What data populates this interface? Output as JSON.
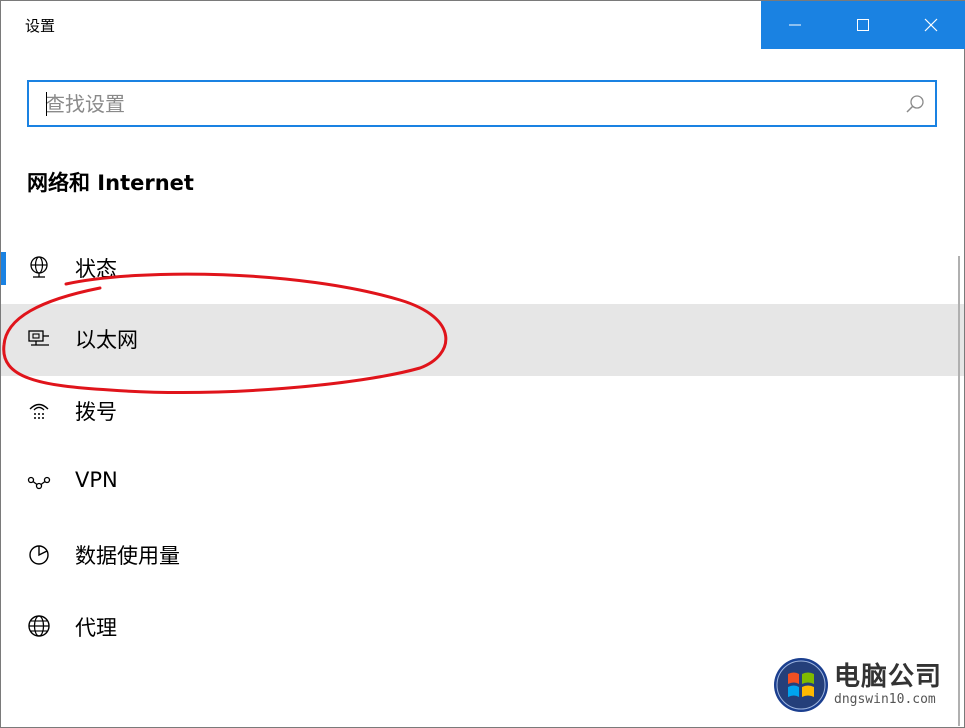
{
  "window": {
    "title": "设置"
  },
  "caption": {
    "minimize_icon": "minimize-icon",
    "maximize_icon": "maximize-icon",
    "close_icon": "close-icon"
  },
  "search": {
    "placeholder": "查找设置",
    "value": "",
    "icon": "search-icon"
  },
  "section": {
    "title": "网络和 Internet"
  },
  "nav": {
    "items": [
      {
        "label": "状态",
        "icon": "globe-status-icon",
        "active": true
      },
      {
        "label": "以太网",
        "icon": "ethernet-icon",
        "highlighted": true
      },
      {
        "label": "拨号",
        "icon": "dialup-icon"
      },
      {
        "label": "VPN",
        "icon": "vpn-icon"
      },
      {
        "label": "数据使用量",
        "icon": "data-usage-icon"
      },
      {
        "label": "代理",
        "icon": "globe-proxy-icon"
      }
    ]
  },
  "watermark": {
    "name": "电脑公司",
    "url": "dngswin10.com"
  },
  "colors": {
    "accent": "#1a82e2",
    "annotation": "#e0141b",
    "hover": "#e6e6e6"
  }
}
